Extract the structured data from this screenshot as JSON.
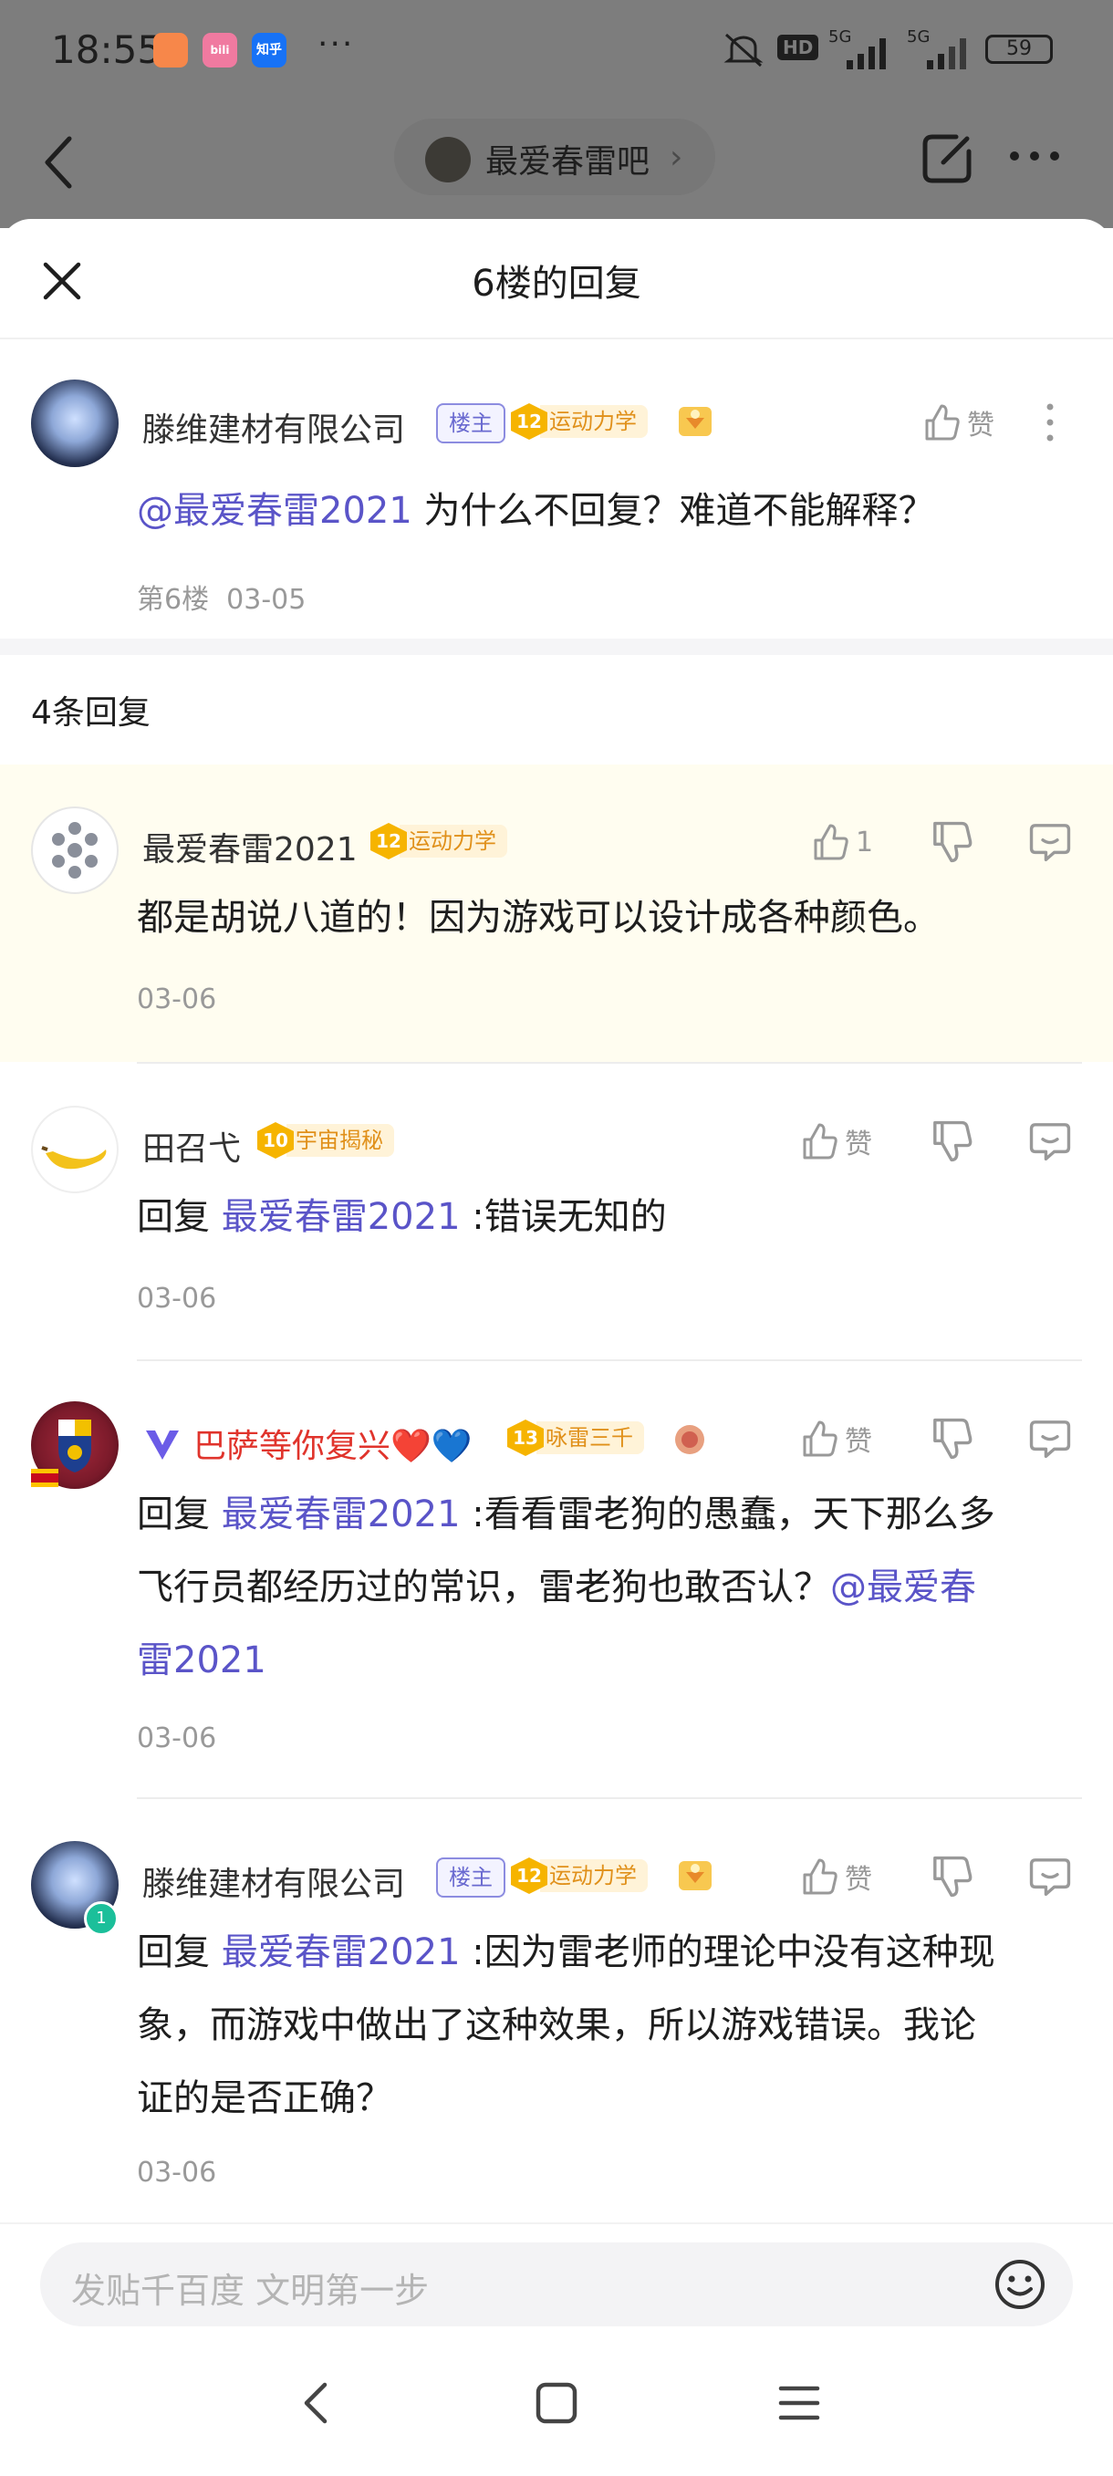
{
  "status": {
    "time": "18:55",
    "apps": [
      "淘宝",
      "bili",
      "知乎"
    ],
    "more": "···",
    "hd": "HD",
    "net1": "5G",
    "net2": "5G",
    "battery": "59"
  },
  "nav": {
    "forum_name": "最爱春雷吧",
    "chevron": "›"
  },
  "sheet": {
    "title": "6楼的回复"
  },
  "main_post": {
    "username": "滕维建材有限公司",
    "badge_owner": "楼主",
    "level": "12",
    "level_title": "运动力学",
    "like_label": "赞",
    "mention": "@最爱春雷2021",
    "text": " 为什么不回复？难道不能解释？",
    "floor": "第6楼",
    "date": "03-05"
  },
  "replies_header": "4条回复",
  "replies": [
    {
      "username": "最爱春雷2021",
      "level": "12",
      "level_title": "运动力学",
      "like_count": "1",
      "text": "都是胡说八道的！因为游戏可以设计成各种颜色。",
      "date": "03-06"
    },
    {
      "username": "田召弋",
      "level": "10",
      "level_title": "宇宙揭秘",
      "like_label": "赞",
      "reply_prefix": "回复 ",
      "reply_to": "最爱春雷2021",
      "text": " :错误无知的",
      "date": "03-06"
    },
    {
      "username": "巴萨等你复兴❤️💙",
      "level": "13",
      "level_title": "咏雷三千",
      "like_label": "赞",
      "reply_prefix": "回复 ",
      "reply_to": "最爱春雷2021",
      "line1": " :看看雷老狗的愚蠢，天下那么多",
      "line2": "飞行员都经历过的常识，雷老狗也敢否认？",
      "mention_a": "@最爱春",
      "mention_b": "雷2021",
      "date": "03-06"
    },
    {
      "username": "滕维建材有限公司",
      "badge_owner": "楼主",
      "level": "12",
      "level_title": "运动力学",
      "like_label": "赞",
      "reply_prefix": "回复 ",
      "reply_to": "最爱春雷2021",
      "line1": " :因为雷老师的理论中没有这种现",
      "line2": "象，而游戏中做出了这种效果，所以游戏错误。我论",
      "line3": "证的是否正确？",
      "date": "03-06"
    }
  ],
  "composer": {
    "placeholder": "发贴千百度 文明第一步"
  },
  "colors": {
    "accent": "#5a54c8",
    "level_gold": "#f6b400",
    "highlight_bg": "#fffdf0"
  }
}
